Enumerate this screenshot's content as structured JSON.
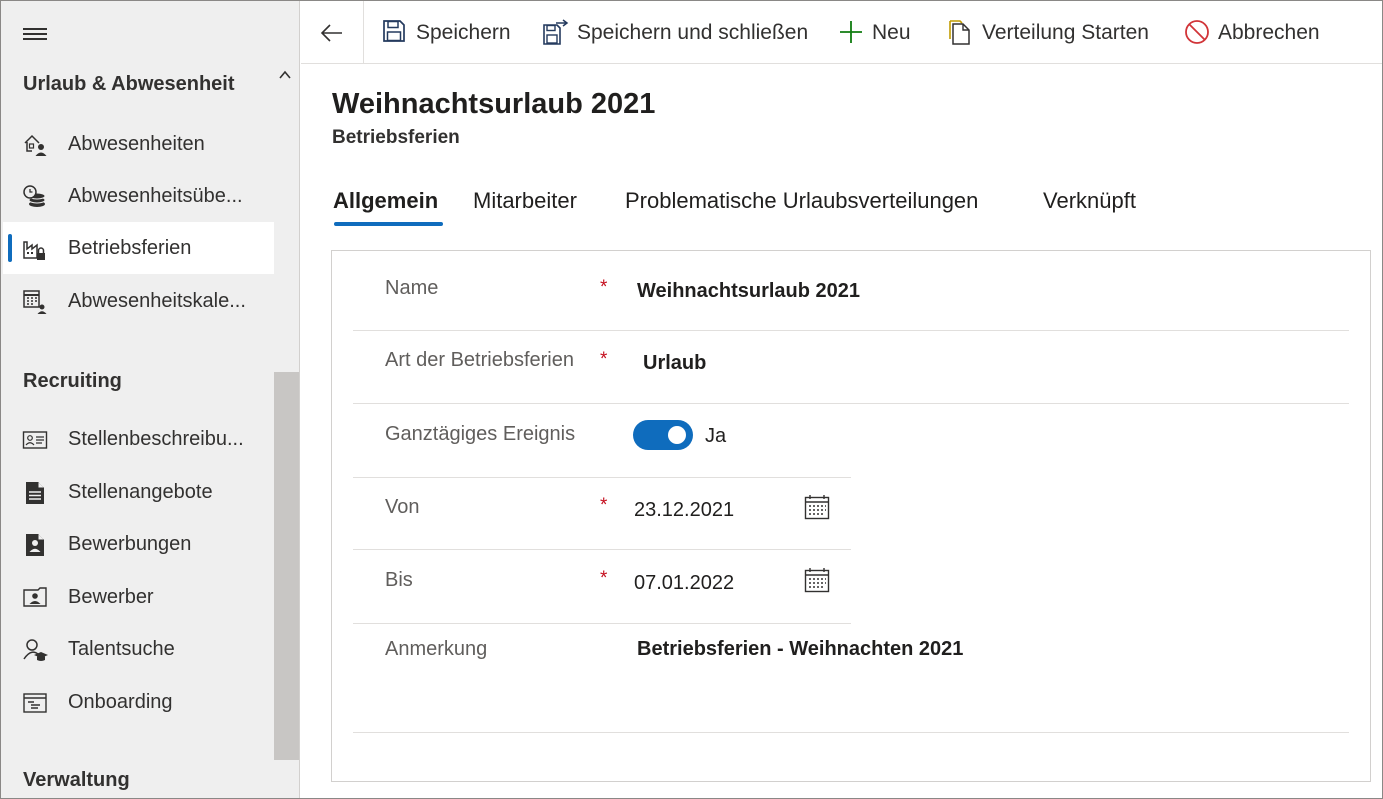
{
  "sidebar": {
    "groups": [
      {
        "title": "Urlaub & Abwesenheit"
      },
      {
        "title": "Recruiting"
      },
      {
        "title": "Verwaltung"
      }
    ],
    "items": [
      {
        "label": "Abwesenheiten",
        "icon": "absence-person-icon"
      },
      {
        "label": "Abwesenheitsübe...",
        "icon": "coins-clock-icon"
      },
      {
        "label": "Betriebsferien",
        "icon": "factory-lock-icon",
        "active": true
      },
      {
        "label": "Abwesenheitskale...",
        "icon": "calendar-person-icon"
      },
      {
        "label": "Stellenbeschreibu...",
        "icon": "id-card-icon"
      },
      {
        "label": "Stellenangebote",
        "icon": "document-lines-icon"
      },
      {
        "label": "Bewerbungen",
        "icon": "document-person-icon"
      },
      {
        "label": "Bewerber",
        "icon": "contact-card-icon"
      },
      {
        "label": "Talentsuche",
        "icon": "person-hat-icon"
      },
      {
        "label": "Onboarding",
        "icon": "onboarding-board-icon"
      }
    ]
  },
  "toolbar": {
    "save": "Speichern",
    "save_close": "Speichern und schließen",
    "new": "Neu",
    "start_distribution": "Verteilung Starten",
    "cancel": "Abbrechen"
  },
  "header": {
    "title": "Weihnachtsurlaub 2021",
    "subtitle": "Betriebsferien"
  },
  "tabs": [
    {
      "label": "Allgemein",
      "active": true
    },
    {
      "label": "Mitarbeiter"
    },
    {
      "label": "Problematische Urlaubsverteilungen"
    },
    {
      "label": "Verknüpft"
    }
  ],
  "form": {
    "required_marker": "*",
    "name": {
      "label": "Name",
      "value": "Weihnachtsurlaub 2021"
    },
    "type": {
      "label": "Art der Betriebsferien",
      "value": "Urlaub"
    },
    "all_day": {
      "label": "Ganztägiges Ereignis",
      "value": "Ja",
      "checked": true
    },
    "from": {
      "label": "Von",
      "value": "23.12.2021"
    },
    "to": {
      "label": "Bis",
      "value": "07.01.2022"
    },
    "note": {
      "label": "Anmerkung",
      "value": "Betriebsferien - Weihnachten 2021"
    }
  },
  "colors": {
    "accent": "#0f6cbd",
    "required": "#c50f1f",
    "sidebar_bg": "#efefef",
    "new_icon": "#107c10",
    "cancel_icon": "#d13438",
    "distribution_icon": "#c19c00"
  }
}
